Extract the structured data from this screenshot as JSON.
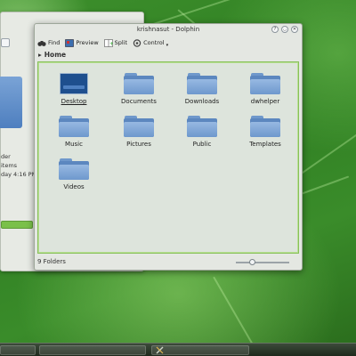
{
  "window": {
    "title": "krishnasut - Dolphin",
    "buttons": {
      "help": "?",
      "minimize": "◡",
      "close": "✕"
    }
  },
  "toolbar": {
    "find_label": "Find",
    "preview_label": "Preview",
    "split_label": "Split",
    "control_label": "Control"
  },
  "breadcrumb": {
    "arrow": "▸",
    "location": "Home"
  },
  "files": [
    {
      "name": "Desktop",
      "icon": "desktop-icon"
    },
    {
      "name": "Documents",
      "icon": "folder-icon"
    },
    {
      "name": "Downloads",
      "icon": "folder-icon"
    },
    {
      "name": "dwhelper",
      "icon": "folder-icon"
    },
    {
      "name": "Music",
      "icon": "folder-icon"
    },
    {
      "name": "Pictures",
      "icon": "folder-icon"
    },
    {
      "name": "Public",
      "icon": "folder-icon"
    },
    {
      "name": "Templates",
      "icon": "folder-icon"
    },
    {
      "name": "Videos",
      "icon": "folder-icon"
    }
  ],
  "status": {
    "text": "9 Folders",
    "zoom_level": 0.3
  },
  "back_window": {
    "info_lines": [
      "der",
      "items",
      "day 4:16 PM"
    ]
  },
  "colors": {
    "accent": "#88c05a",
    "folder": "#6e98cd",
    "background": "#3a8c2a"
  }
}
